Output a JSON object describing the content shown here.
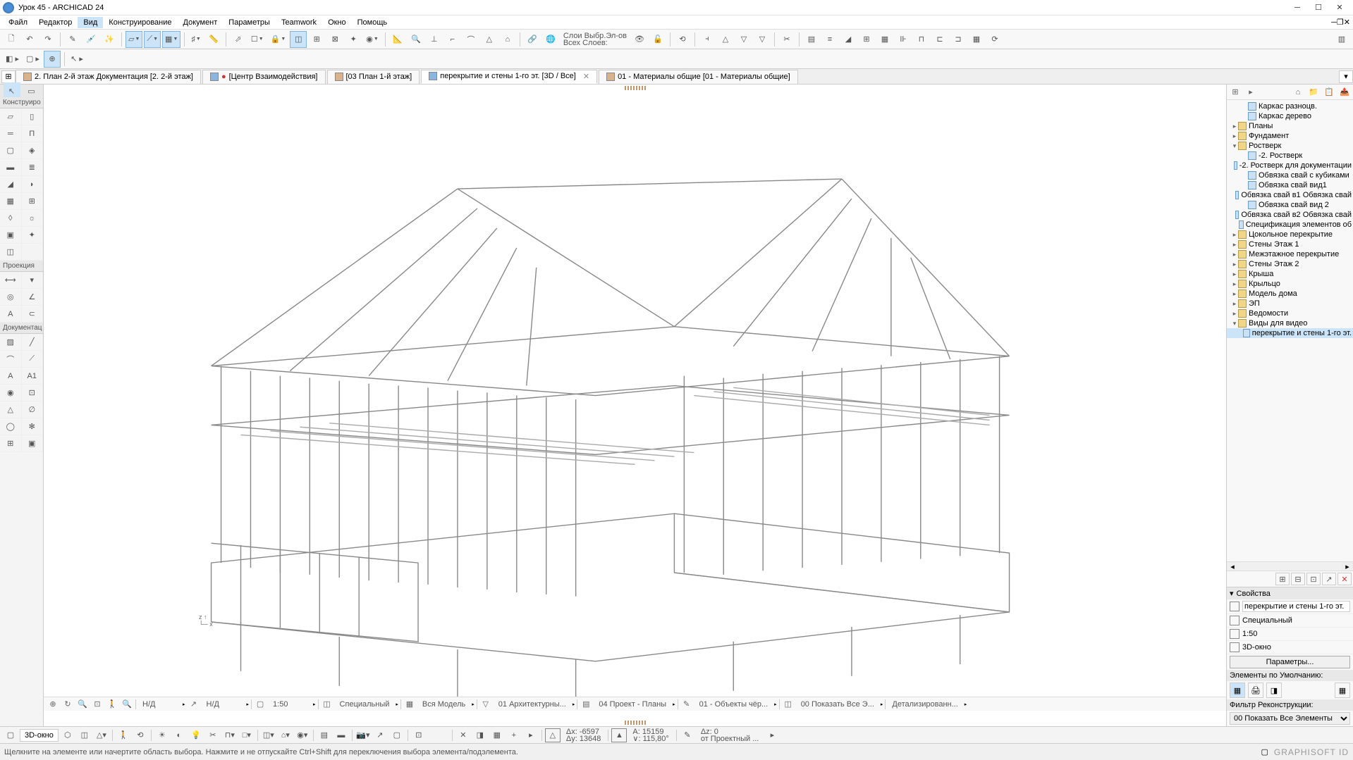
{
  "title": "Урок 45 - ARCHICAD 24",
  "menu": [
    "Файл",
    "Редактор",
    "Вид",
    "Конструирование",
    "Документ",
    "Параметры",
    "Teamwork",
    "Окно",
    "Помощь"
  ],
  "menu_active": 2,
  "layer_label1": "Слои Выбр.Эл-ов",
  "layer_label2": "Всех Слоев:",
  "tabs": [
    {
      "label": "2. План 2-й этаж Документация [2. 2-й этаж]",
      "active": false
    },
    {
      "label": "[Центр Взаимодействия]",
      "active": false,
      "dirty": true
    },
    {
      "label": "[03 План 1-й этаж]",
      "active": false
    },
    {
      "label": "перекрытие и стены 1-го эт. [3D / Все]",
      "active": true,
      "closable": true
    },
    {
      "label": "01 - Материалы общие [01 - Материалы общие]",
      "active": false
    }
  ],
  "toolbox": {
    "sections": [
      "Конструиро",
      "Проекция",
      "Документац"
    ]
  },
  "navigator": {
    "items": [
      {
        "indent": 1,
        "icon": "sheet",
        "label": "Каркас разноцв."
      },
      {
        "indent": 1,
        "icon": "sheet",
        "label": "Каркас дерево"
      },
      {
        "indent": 0,
        "expand": "▸",
        "icon": "folder",
        "label": "Планы"
      },
      {
        "indent": 0,
        "expand": "▸",
        "icon": "folder",
        "label": "Фундамент"
      },
      {
        "indent": 0,
        "expand": "▾",
        "icon": "folder",
        "label": "Ростверк"
      },
      {
        "indent": 1,
        "icon": "sheet",
        "label": "-2. Ростверк"
      },
      {
        "indent": 1,
        "icon": "sheet",
        "label": "-2. Ростверк для документации"
      },
      {
        "indent": 1,
        "icon": "sheet",
        "label": "Обвязка свай с кубиками"
      },
      {
        "indent": 1,
        "icon": "sheet",
        "label": "Обвязка свай вид1"
      },
      {
        "indent": 1,
        "icon": "sheet",
        "label": "Обвязка свай в1 Обвязка свай"
      },
      {
        "indent": 1,
        "icon": "sheet",
        "label": "Обвязка свай вид 2"
      },
      {
        "indent": 1,
        "icon": "sheet",
        "label": "Обвязка свай в2 Обвязка свай"
      },
      {
        "indent": 1,
        "icon": "sheet",
        "label": "Спецификация элементов об"
      },
      {
        "indent": 0,
        "expand": "▸",
        "icon": "folder",
        "label": "Цокольное перекрытие"
      },
      {
        "indent": 0,
        "expand": "▸",
        "icon": "folder",
        "label": "Стены Этаж 1"
      },
      {
        "indent": 0,
        "expand": "▸",
        "icon": "folder",
        "label": "Межэтажное перекрытие"
      },
      {
        "indent": 0,
        "expand": "▸",
        "icon": "folder",
        "label": "Стены Этаж 2"
      },
      {
        "indent": 0,
        "expand": "▸",
        "icon": "folder",
        "label": "Крыша"
      },
      {
        "indent": 0,
        "expand": "▸",
        "icon": "folder",
        "label": "Крыльцо"
      },
      {
        "indent": 0,
        "expand": "▸",
        "icon": "folder",
        "label": "Модель дома"
      },
      {
        "indent": 0,
        "expand": "▸",
        "icon": "folder",
        "label": "ЭП"
      },
      {
        "indent": 0,
        "expand": "▸",
        "icon": "folder",
        "label": "Ведомости"
      },
      {
        "indent": 0,
        "expand": "▾",
        "icon": "folder",
        "label": "Виды для видео"
      },
      {
        "indent": 1,
        "icon": "sheet",
        "label": "перекрытие и стены 1-го эт.",
        "selected": true
      }
    ]
  },
  "props": {
    "title": "Свойства",
    "name": "перекрытие и стены 1-го эт.",
    "row2": "Специальный",
    "scale": "1:50",
    "view": "3D-окно",
    "params_btn": "Параметры...",
    "defaults_label": "Элементы по Умолчанию:",
    "filter_label": "Фильтр Реконструкции:",
    "filter_value": "00 Показать Все Элементы"
  },
  "quickbar": {
    "na": "Н/Д",
    "scale": "1:50",
    "special": "Специальный",
    "model": "Вся Модель",
    "arch": "01 Архитектурны...",
    "plans": "04 Проект - Планы",
    "objects": "01 - Объекты чёр...",
    "show": "00 Показать Все Э...",
    "detail": "Детализированн..."
  },
  "cmdbar": {
    "viewname": "3D-окно",
    "dx": "Δx: -6597",
    "dy": "Δy: 13648",
    "a": "A: 15159",
    "v": "∨: 115,80°",
    "dz": "Δz: 0",
    "proj": "от Проектный ..."
  },
  "status": "Щелкните на элементе или начертите область выбора. Нажмите и не отпускайте Ctrl+Shift для переключения выбора элемента/подэлемента.",
  "logo": "GRAPHISOFT ID"
}
